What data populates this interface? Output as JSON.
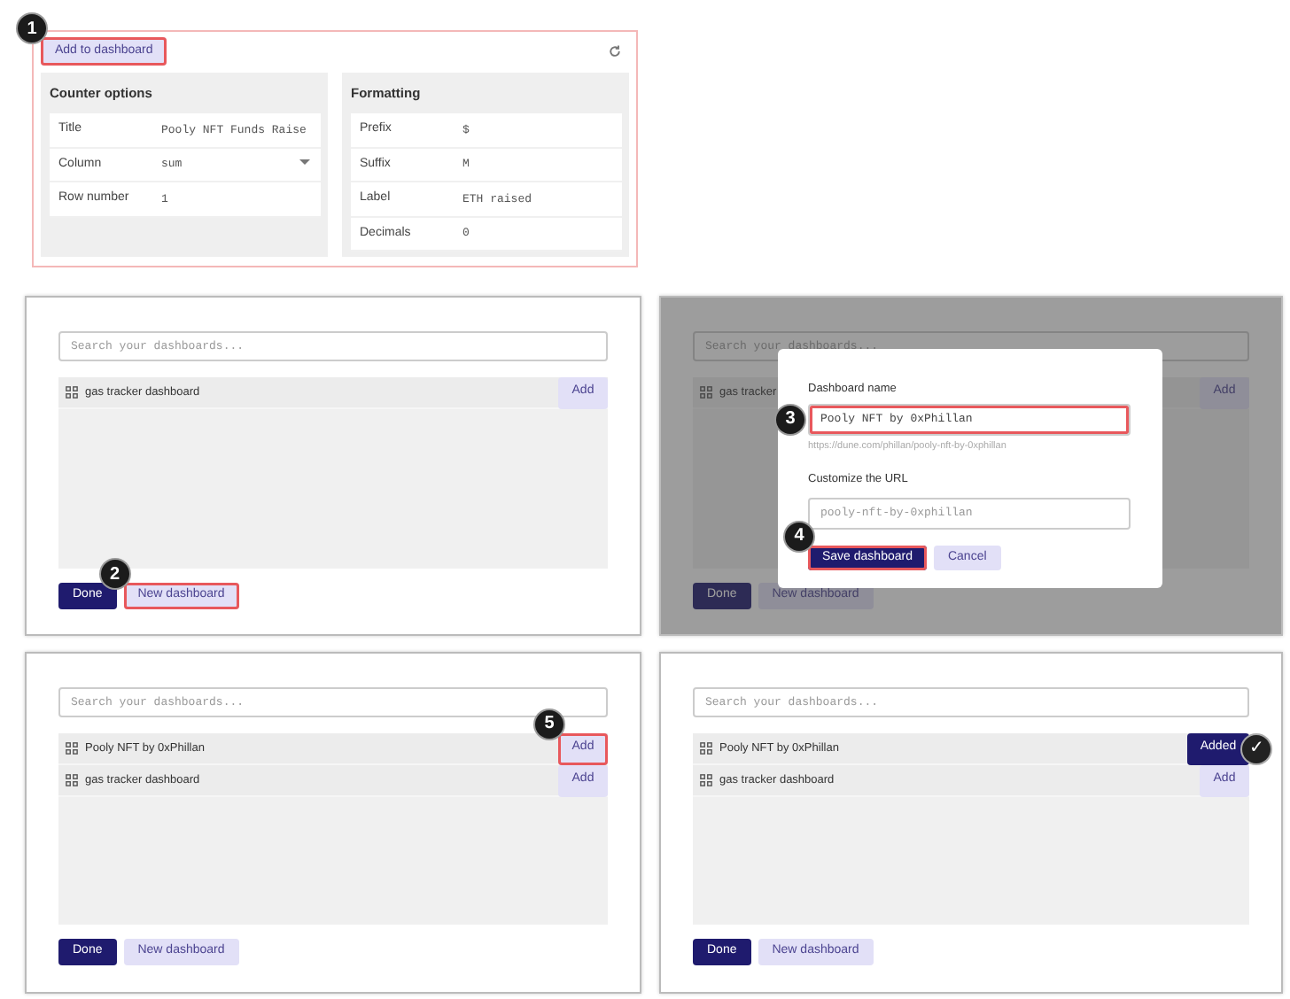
{
  "step1": {
    "button": {
      "label": "Add to dashboard",
      "highlighted": true,
      "badge": "1"
    },
    "cards": [
      {
        "title": "Counter options",
        "rows": [
          {
            "label": "Title",
            "value": "Pooly NFT Funds Raise",
            "kind": "text"
          },
          {
            "label": "Column",
            "value": "sum",
            "kind": "select"
          },
          {
            "label": "Row number",
            "value": "1",
            "kind": "text"
          }
        ]
      },
      {
        "title": "Formatting",
        "rows": [
          {
            "label": "Prefix",
            "value": "$",
            "kind": "text"
          },
          {
            "label": "Suffix",
            "value": "M",
            "kind": "text"
          },
          {
            "label": "Label",
            "value": "ETH raised",
            "kind": "text"
          },
          {
            "label": "Decimals",
            "value": "0",
            "kind": "text"
          }
        ]
      }
    ]
  },
  "panels": [
    {
      "dimmed": false,
      "search": {
        "placeholder": "Search your dashboards..."
      },
      "dashboards": [
        {
          "name": "gas tracker dashboard",
          "action": "Add",
          "added": false,
          "highlighted": false
        }
      ],
      "done": "Done",
      "new_dashboard": {
        "label": "New dashboard",
        "highlighted": true,
        "badge": "2"
      }
    },
    {
      "dimmed": true,
      "search": {
        "placeholder": "Search your dashboards..."
      },
      "dashboards": [
        {
          "name": "gas tracker",
          "action": "Add",
          "added": false,
          "highlighted": false
        }
      ],
      "done": "Done",
      "new_dashboard": {
        "label": "New dashboard",
        "highlighted": false
      },
      "dialog": {
        "name_label": "Dashboard name",
        "name_value": "Pooly NFT by 0xPhillan",
        "name_highlighted": true,
        "name_badge": "3",
        "url_hint": "https://dune.com/phillan/pooly-nft-by-0xphillan",
        "url_label": "Customize the URL",
        "url_placeholder": "pooly-nft-by-0xphillan",
        "save": {
          "label": "Save dashboard",
          "highlighted": true,
          "badge": "4"
        },
        "cancel": "Cancel"
      }
    },
    {
      "dimmed": false,
      "search": {
        "placeholder": "Search your dashboards..."
      },
      "dashboards": [
        {
          "name": "Pooly NFT by 0xPhillan",
          "action": "Add",
          "added": false,
          "highlighted": true,
          "badge": "5"
        },
        {
          "name": "gas tracker dashboard",
          "action": "Add",
          "added": false,
          "highlighted": false
        }
      ],
      "done": "Done",
      "new_dashboard": {
        "label": "New dashboard",
        "highlighted": false
      }
    },
    {
      "dimmed": false,
      "search": {
        "placeholder": "Search your dashboards..."
      },
      "dashboards": [
        {
          "name": "Pooly NFT by 0xPhillan",
          "action": "Added",
          "added": true,
          "highlighted": false,
          "confirmation": "✓"
        },
        {
          "name": "gas tracker dashboard",
          "action": "Add",
          "added": false,
          "highlighted": false
        }
      ],
      "done": "Done",
      "new_dashboard": {
        "label": "New dashboard",
        "highlighted": false
      }
    }
  ]
}
